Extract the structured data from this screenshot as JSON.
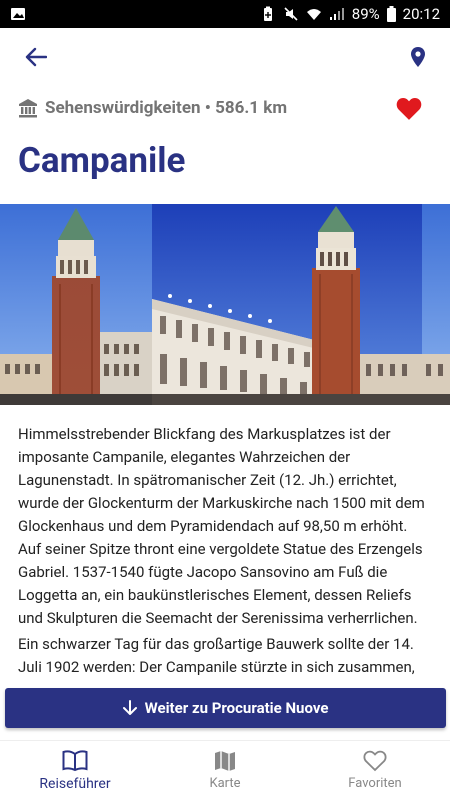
{
  "status_bar": {
    "battery": "89%",
    "time": "20:12"
  },
  "app_bar": {
    "back_icon": "arrow-left-icon",
    "map_pin_icon": "location-pin-icon"
  },
  "place": {
    "category_icon": "landmark-icon",
    "category_line": "Sehenswürdigkeiten • 586.1 km",
    "title": "Campanile",
    "favorite": true,
    "description": [
      "Himmelsstrebender Blickfang des Markusplatzes ist der imposante Campanile, elegantes Wahrzeichen der Lagunenstadt. In spätromanischer Zeit (12. Jh.) errichtet, wurde der Glockenturm der Markuskirche nach 1500 mit dem Glockenhaus und dem Pyramidendach auf 98,50 m erhöht. Auf seiner Spitze thront eine vergoldete Statue des Erzengels Gabriel. 1537-1540 fügte Jacopo Sansovino am Fuß die Loggetta an, ein baukünstlerisches Element, dessen Reliefs und Skulpturen die Seemacht der Serenissima verherrlichen.",
      "Ein schwarzer Tag für das großartige Bauwerk sollte der 14. Juli 1902 werden: Der Campanile stürzte in sich zusammen,"
    ]
  },
  "next_button": {
    "label": "Weiter zu Procuratie Nuove"
  },
  "bottom_nav": [
    {
      "label": "Reiseführer",
      "icon": "book-open-icon",
      "active": true
    },
    {
      "label": "Karte",
      "icon": "map-icon",
      "active": false
    },
    {
      "label": "Favoriten",
      "icon": "heart-outline-icon",
      "active": false
    }
  ],
  "colors": {
    "primary": "#2a3283",
    "heart": "#e0191e",
    "meta_gray": "#747474"
  }
}
